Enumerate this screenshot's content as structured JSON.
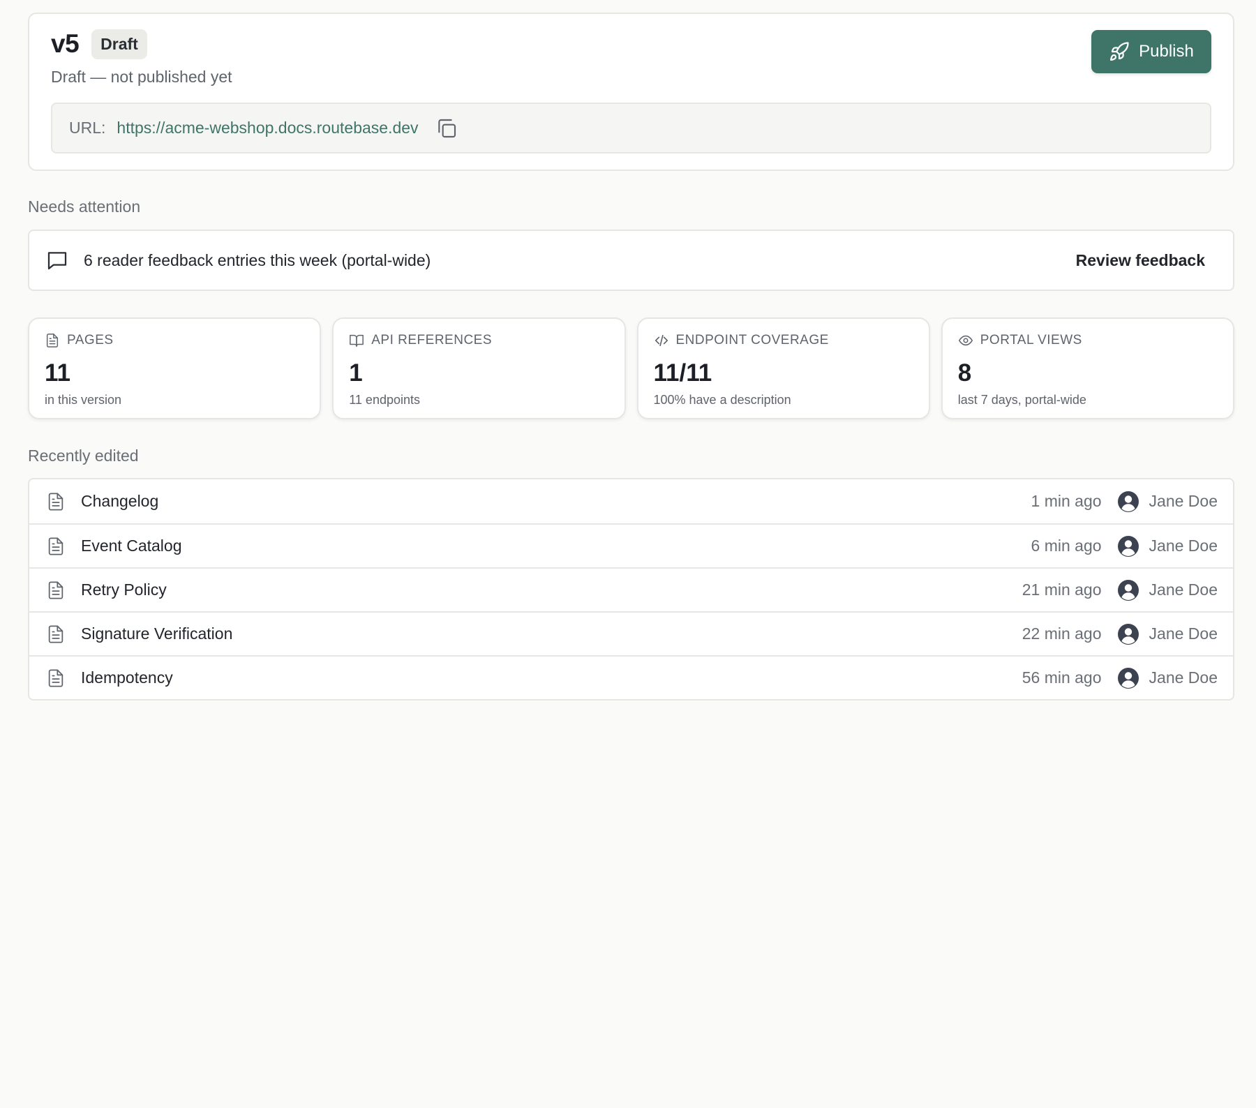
{
  "version": {
    "label": "v5",
    "badge": "Draft",
    "status": "Draft — not published yet",
    "publish_label": "Publish",
    "url_label": "URL:",
    "url": "https://acme-webshop.docs.routebase.dev"
  },
  "attention": {
    "title": "Needs attention",
    "message": "6 reader feedback entries this week (portal-wide)",
    "action": "Review feedback"
  },
  "stats": [
    {
      "icon": "file-icon",
      "label": "PAGES",
      "value": "11",
      "sub": "in this version"
    },
    {
      "icon": "book-icon",
      "label": "API REFERENCES",
      "value": "1",
      "sub": "11 endpoints"
    },
    {
      "icon": "code-icon",
      "label": "ENDPOINT COVERAGE",
      "value": "11/11",
      "sub": "100% have a description"
    },
    {
      "icon": "eye-icon",
      "label": "PORTAL VIEWS",
      "value": "8",
      "sub": "last 7 days, portal-wide"
    }
  ],
  "recent": {
    "title": "Recently edited",
    "items": [
      {
        "title": "Changelog",
        "time": "1 min ago",
        "user": "Jane Doe"
      },
      {
        "title": "Event Catalog",
        "time": "6 min ago",
        "user": "Jane Doe"
      },
      {
        "title": "Retry Policy",
        "time": "21 min ago",
        "user": "Jane Doe"
      },
      {
        "title": "Signature Verification",
        "time": "22 min ago",
        "user": "Jane Doe"
      },
      {
        "title": "Idempotency",
        "time": "56 min ago",
        "user": "Jane Doe"
      }
    ]
  },
  "colors": {
    "accent": "#3f7568",
    "border": "#e6e6e3",
    "background": "#fafaf9"
  }
}
